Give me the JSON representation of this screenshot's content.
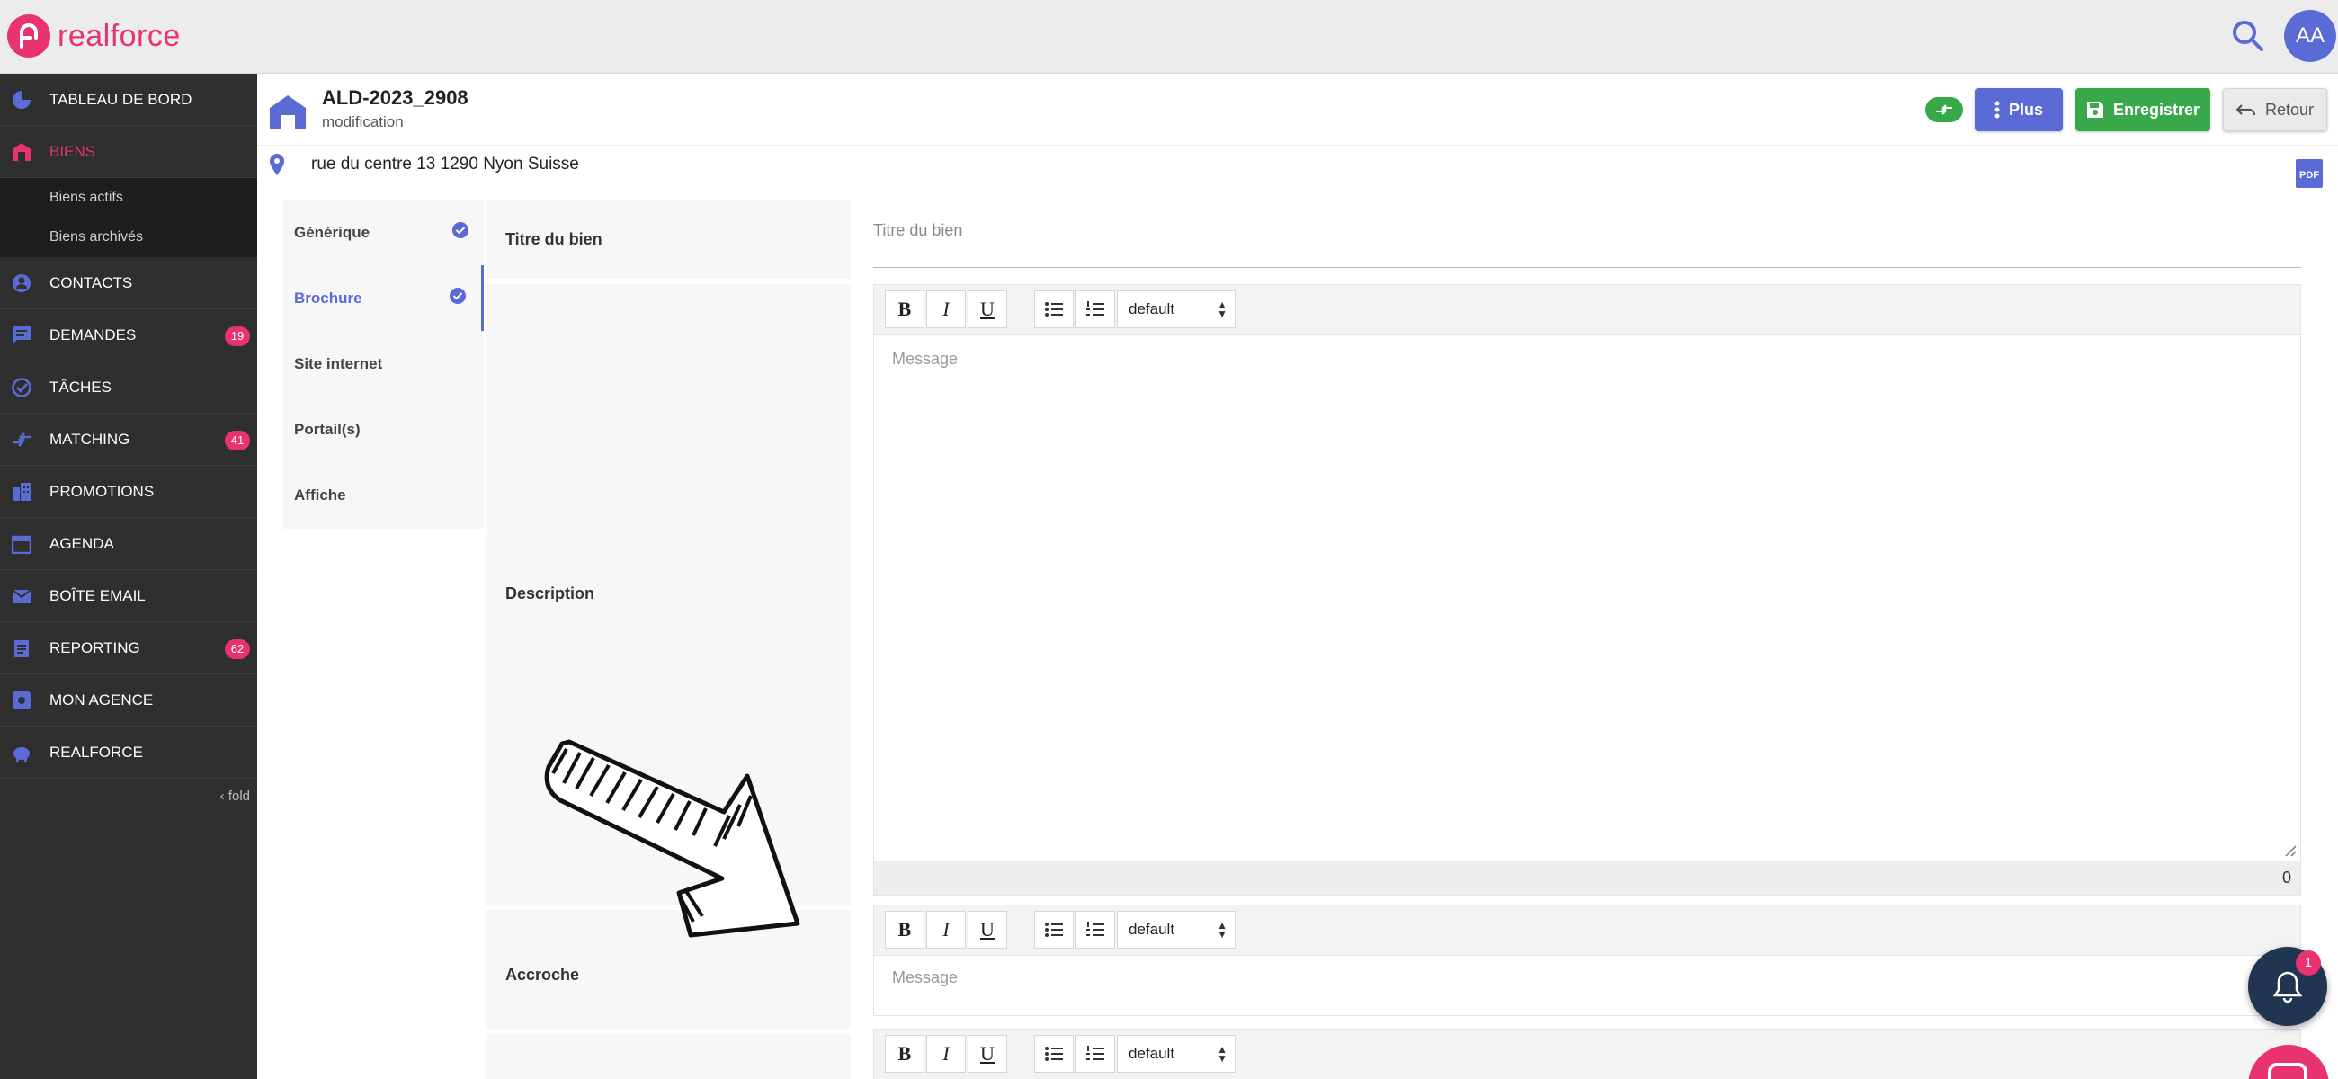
{
  "brand": {
    "name": "realforce",
    "color": "#e8336e"
  },
  "user": {
    "initials": "AA"
  },
  "sidebar": {
    "items": [
      {
        "label": "TABLEAU DE BORD",
        "icon": "pie-chart-icon"
      },
      {
        "label": "BIENS",
        "icon": "building-icon",
        "active": true
      },
      {
        "label": "CONTACTS",
        "icon": "person-icon"
      },
      {
        "label": "DEMANDES",
        "icon": "chat-icon",
        "badge": "19"
      },
      {
        "label": "TÂCHES",
        "icon": "check-circle-icon"
      },
      {
        "label": "MATCHING",
        "icon": "swap-icon",
        "badge": "41"
      },
      {
        "label": "PROMOTIONS",
        "icon": "buildings-icon"
      },
      {
        "label": "AGENDA",
        "icon": "calendar-icon"
      },
      {
        "label": "BOÎTE EMAIL",
        "icon": "mail-icon"
      },
      {
        "label": "REPORTING",
        "icon": "clipboard-icon",
        "badge": "62"
      },
      {
        "label": "MON AGENCE",
        "icon": "agency-icon"
      },
      {
        "label": "REALFORCE",
        "icon": "piggy-icon"
      }
    ],
    "sub_items": [
      "Biens actifs",
      "Biens archivés"
    ],
    "fold_label": "fold"
  },
  "header": {
    "title": "ALD-2023_2908",
    "subtitle": "modification",
    "plus_label": "Plus",
    "save_label": "Enregistrer",
    "back_label": "Retour",
    "address": "rue du centre 13 1290 Nyon Suisse"
  },
  "tabs": [
    {
      "label": "Générique",
      "checked": true
    },
    {
      "label": "Brochure",
      "checked": true,
      "active": true
    },
    {
      "label": "Site internet",
      "checked": false
    },
    {
      "label": "Portail(s)",
      "checked": false
    },
    {
      "label": "Affiche",
      "checked": false
    }
  ],
  "form": {
    "title_label": "Titre du bien",
    "title_placeholder": "Titre du bien",
    "description_label": "Description",
    "accroche_label": "Accroche",
    "message_placeholder": "Message",
    "select_value": "default",
    "char_count": "0"
  },
  "toolbar": {
    "bold": "B",
    "italic": "I",
    "underline": "U"
  },
  "notifications": {
    "count": "1"
  },
  "colors": {
    "primary": "#5b6bd5",
    "success": "#38a84a",
    "sidebar": "#2f2f2f"
  }
}
